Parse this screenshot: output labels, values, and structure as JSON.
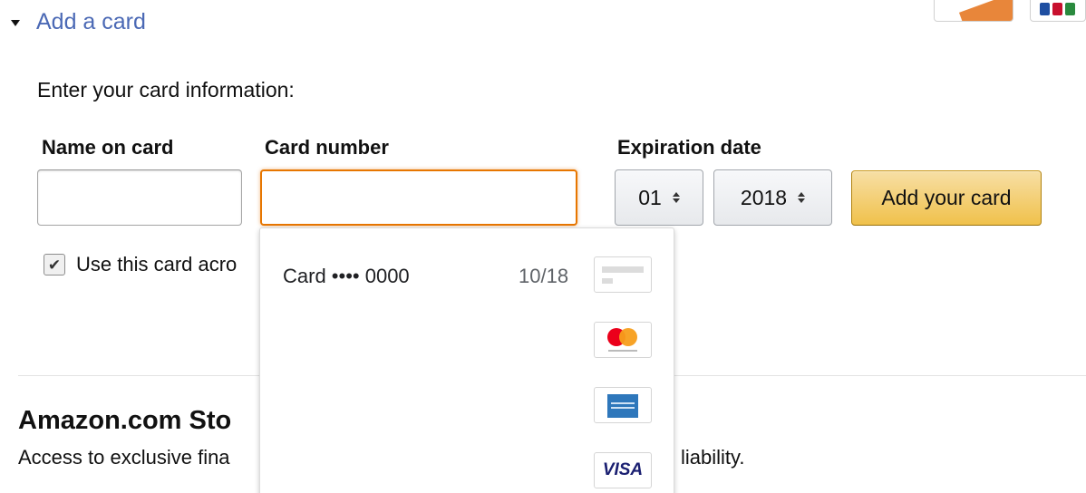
{
  "section": {
    "toggle_label": "Add a card"
  },
  "form": {
    "intro": "Enter your card information:",
    "name_label": "Name on card",
    "number_label": "Card number",
    "expiration_label": "Expiration date",
    "name_value": "",
    "number_value": "",
    "exp_month": "01",
    "exp_year": "2018",
    "submit_label": "Add your card",
    "checkbox_checked": true,
    "checkbox_label": "Use this card acro"
  },
  "autofill": {
    "suggestion_label": "Card •••• 0000",
    "suggestion_exp": "10/18",
    "icons": [
      "generic-card-icon",
      "mastercard-icon",
      "amex-icon",
      "visa-icon"
    ],
    "visa_text": "VISA"
  },
  "store": {
    "title": "Amazon.com Sto",
    "desc_start": "Access to exclusive fina",
    "desc_end": "liability."
  },
  "colors": {
    "link": "#4b69b5",
    "focus_orange": "#e77600",
    "button_gold": "#f0c14b"
  }
}
